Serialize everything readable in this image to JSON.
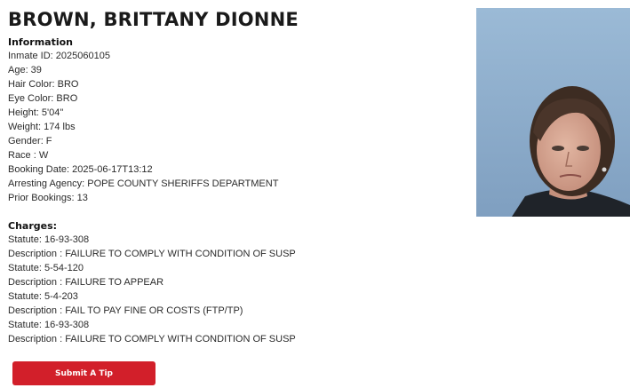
{
  "inmate": {
    "name": "BROWN, BRITTANY DIONNE"
  },
  "information": {
    "heading": "Information",
    "lines": [
      "Inmate ID: 2025060105",
      "Age: 39",
      "Hair Color: BRO",
      "Eye Color: BRO",
      "Height: 5'04\"",
      "Weight: 174 lbs",
      "Gender: F",
      "Race : W",
      "Booking Date: 2025-06-17T13:12",
      "Arresting Agency: POPE COUNTY SHERIFFS DEPARTMENT",
      "Prior Bookings: 13"
    ]
  },
  "charges": {
    "heading": "Charges:",
    "lines": [
      "Statute: 16-93-308",
      "Description : FAILURE TO COMPLY WITH CONDITION OF SUSP",
      "Statute: 5-54-120",
      "Description : FAILURE TO APPEAR",
      "Statute: 5-4-203",
      "Description : FAIL TO PAY FINE OR COSTS (FTP/TP)",
      "Statute: 16-93-308",
      "Description : FAILURE TO COMPLY WITH CONDITION OF SUSP"
    ]
  },
  "actions": {
    "submit_tip_label": "Submit A Tip"
  },
  "colors": {
    "button_bg": "#d21f2a",
    "photo_bg": "#8fb0cf"
  }
}
